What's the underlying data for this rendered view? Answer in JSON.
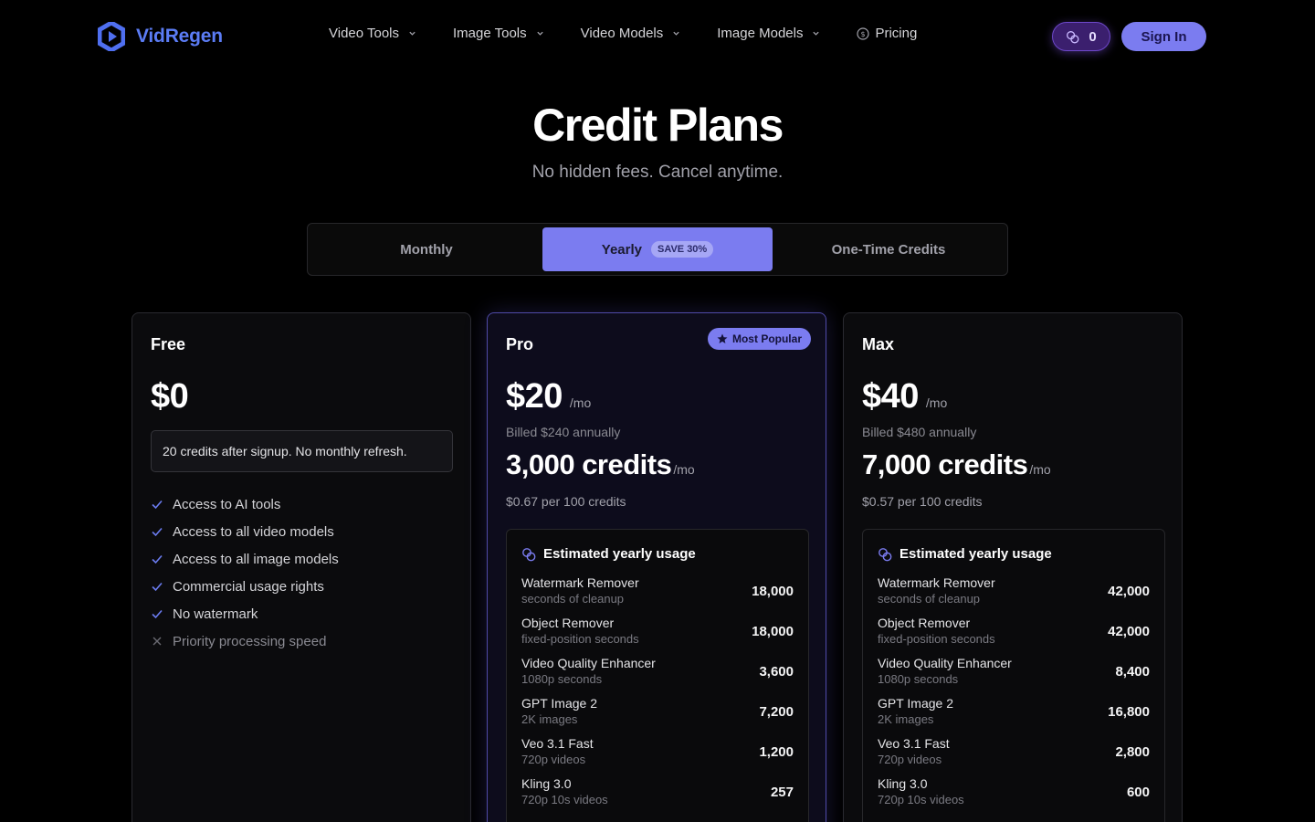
{
  "brand": {
    "name": "VidRegen"
  },
  "nav": {
    "items": [
      {
        "label": "Video Tools"
      },
      {
        "label": "Image Tools"
      },
      {
        "label": "Video Models"
      },
      {
        "label": "Image Models"
      }
    ],
    "pricing": "Pricing"
  },
  "header": {
    "credits": "0",
    "signin": "Sign In"
  },
  "hero": {
    "title": "Credit Plans",
    "subtitle": "No hidden fees. Cancel anytime."
  },
  "tabs": {
    "monthly": "Monthly",
    "yearly": "Yearly",
    "save_badge": "SAVE 30%",
    "onetime": "One-Time Credits",
    "active": "yearly"
  },
  "colors": {
    "accent": "#7b7cf0",
    "brand": "#5b7cf5",
    "background": "#000000"
  },
  "plans": {
    "free": {
      "name": "Free",
      "price": "$0",
      "note": "20 credits after signup. No monthly refresh.",
      "features": [
        {
          "label": "Access to AI tools",
          "included": true
        },
        {
          "label": "Access to all video models",
          "included": true
        },
        {
          "label": "Access to all image models",
          "included": true
        },
        {
          "label": "Commercial usage rights",
          "included": true
        },
        {
          "label": "No watermark",
          "included": true
        },
        {
          "label": "Priority processing speed",
          "included": false
        }
      ]
    },
    "pro": {
      "name": "Pro",
      "badge": "Most Popular",
      "price": "$20",
      "per": "/mo",
      "billed": "Billed $240 annually",
      "credits": "3,000 credits",
      "credits_per": "/mo",
      "per100": "$0.67 per 100 credits",
      "usage_title": "Estimated yearly usage",
      "usage": [
        {
          "name": "Watermark Remover",
          "sub": "seconds of cleanup",
          "value": "18,000"
        },
        {
          "name": "Object Remover",
          "sub": "fixed-position seconds",
          "value": "18,000"
        },
        {
          "name": "Video Quality Enhancer",
          "sub": "1080p seconds",
          "value": "3,600"
        },
        {
          "name": "GPT Image 2",
          "sub": "2K images",
          "value": "7,200"
        },
        {
          "name": "Veo 3.1 Fast",
          "sub": "720p videos",
          "value": "1,200"
        },
        {
          "name": "Kling 3.0",
          "sub": "720p 10s videos",
          "value": "257"
        }
      ]
    },
    "max": {
      "name": "Max",
      "price": "$40",
      "per": "/mo",
      "billed": "Billed $480 annually",
      "credits": "7,000 credits",
      "credits_per": "/mo",
      "per100": "$0.57 per 100 credits",
      "usage_title": "Estimated yearly usage",
      "usage": [
        {
          "name": "Watermark Remover",
          "sub": "seconds of cleanup",
          "value": "42,000"
        },
        {
          "name": "Object Remover",
          "sub": "fixed-position seconds",
          "value": "42,000"
        },
        {
          "name": "Video Quality Enhancer",
          "sub": "1080p seconds",
          "value": "8,400"
        },
        {
          "name": "GPT Image 2",
          "sub": "2K images",
          "value": "16,800"
        },
        {
          "name": "Veo 3.1 Fast",
          "sub": "720p videos",
          "value": "2,800"
        },
        {
          "name": "Kling 3.0",
          "sub": "720p 10s videos",
          "value": "600"
        }
      ]
    }
  }
}
